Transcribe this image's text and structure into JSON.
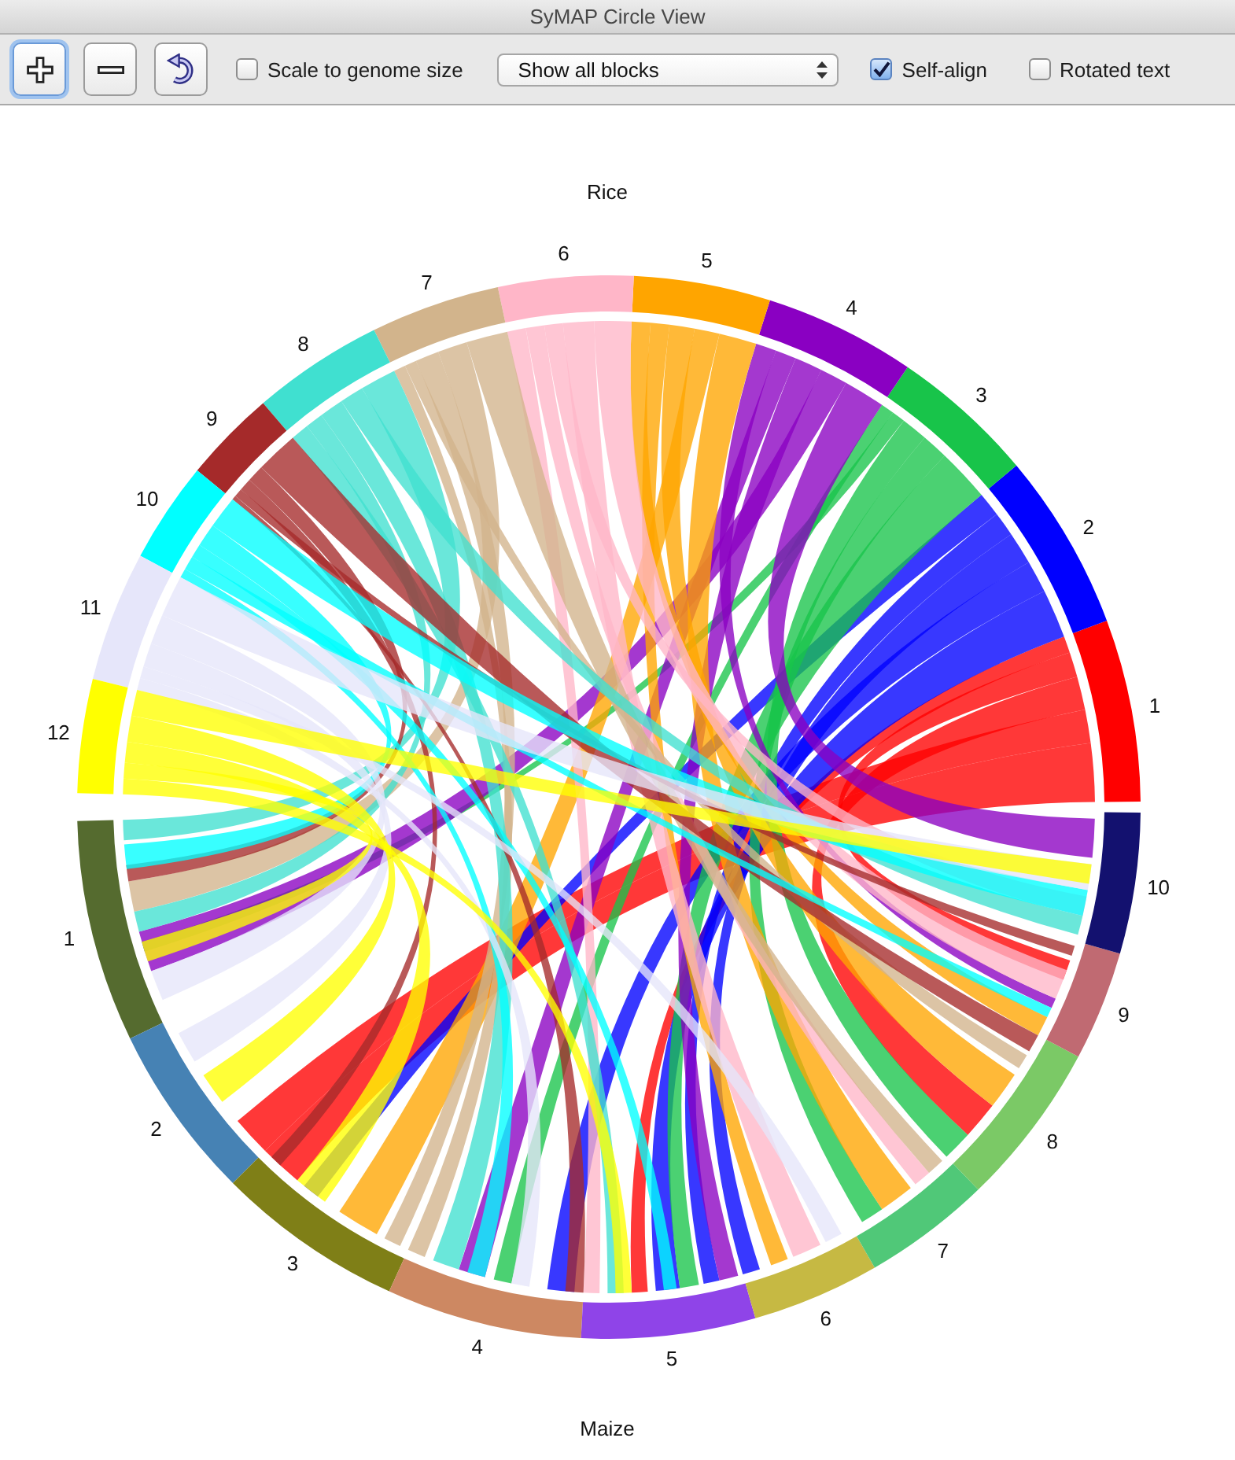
{
  "window": {
    "title": "SyMAP Circle View"
  },
  "toolbar": {
    "buttons": [
      {
        "kind": "zoom-in",
        "focused": true
      },
      {
        "kind": "zoom-out",
        "focused": false
      },
      {
        "kind": "rotate",
        "focused": false
      }
    ],
    "scale_option": {
      "label": "Scale to genome size",
      "checked": false
    },
    "block_filter": {
      "value": "Show all blocks"
    },
    "align_options": [
      {
        "label": "Self-align",
        "checked": true
      },
      {
        "label": "Rotated text",
        "checked": false
      }
    ]
  },
  "circle_view": {
    "top_genome": "Rice",
    "bottom_genome": "Maize",
    "top_chromosomes": [
      {
        "label": "1",
        "color": "#ff0000"
      },
      {
        "label": "2",
        "color": "#0000ff"
      },
      {
        "label": "3",
        "color": "#18c44a"
      },
      {
        "label": "4",
        "color": "#8a00c2"
      },
      {
        "label": "5",
        "color": "#ffa500"
      },
      {
        "label": "6",
        "color": "#ffb6c8"
      },
      {
        "label": "7",
        "color": "#d2b48c"
      },
      {
        "label": "8",
        "color": "#40e0d0"
      },
      {
        "label": "9",
        "color": "#a52a2a"
      },
      {
        "label": "10",
        "color": "#00ffff"
      },
      {
        "label": "11",
        "color": "#e6e6fa"
      },
      {
        "label": "12",
        "color": "#ffff00"
      }
    ],
    "bottom_chromosomes": [
      {
        "label": "1",
        "color": "#556b2f"
      },
      {
        "label": "2",
        "color": "#4682b4"
      },
      {
        "label": "3",
        "color": "#7f7f17"
      },
      {
        "label": "4",
        "color": "#cd8862"
      },
      {
        "label": "5",
        "color": "#8f44e8"
      },
      {
        "label": "6",
        "color": "#c6b943"
      },
      {
        "label": "7",
        "color": "#50c878"
      },
      {
        "label": "8",
        "color": "#7bc966"
      },
      {
        "label": "9",
        "color": "#c06a72"
      },
      {
        "label": "10",
        "color": "#13116f"
      }
    ]
  }
}
